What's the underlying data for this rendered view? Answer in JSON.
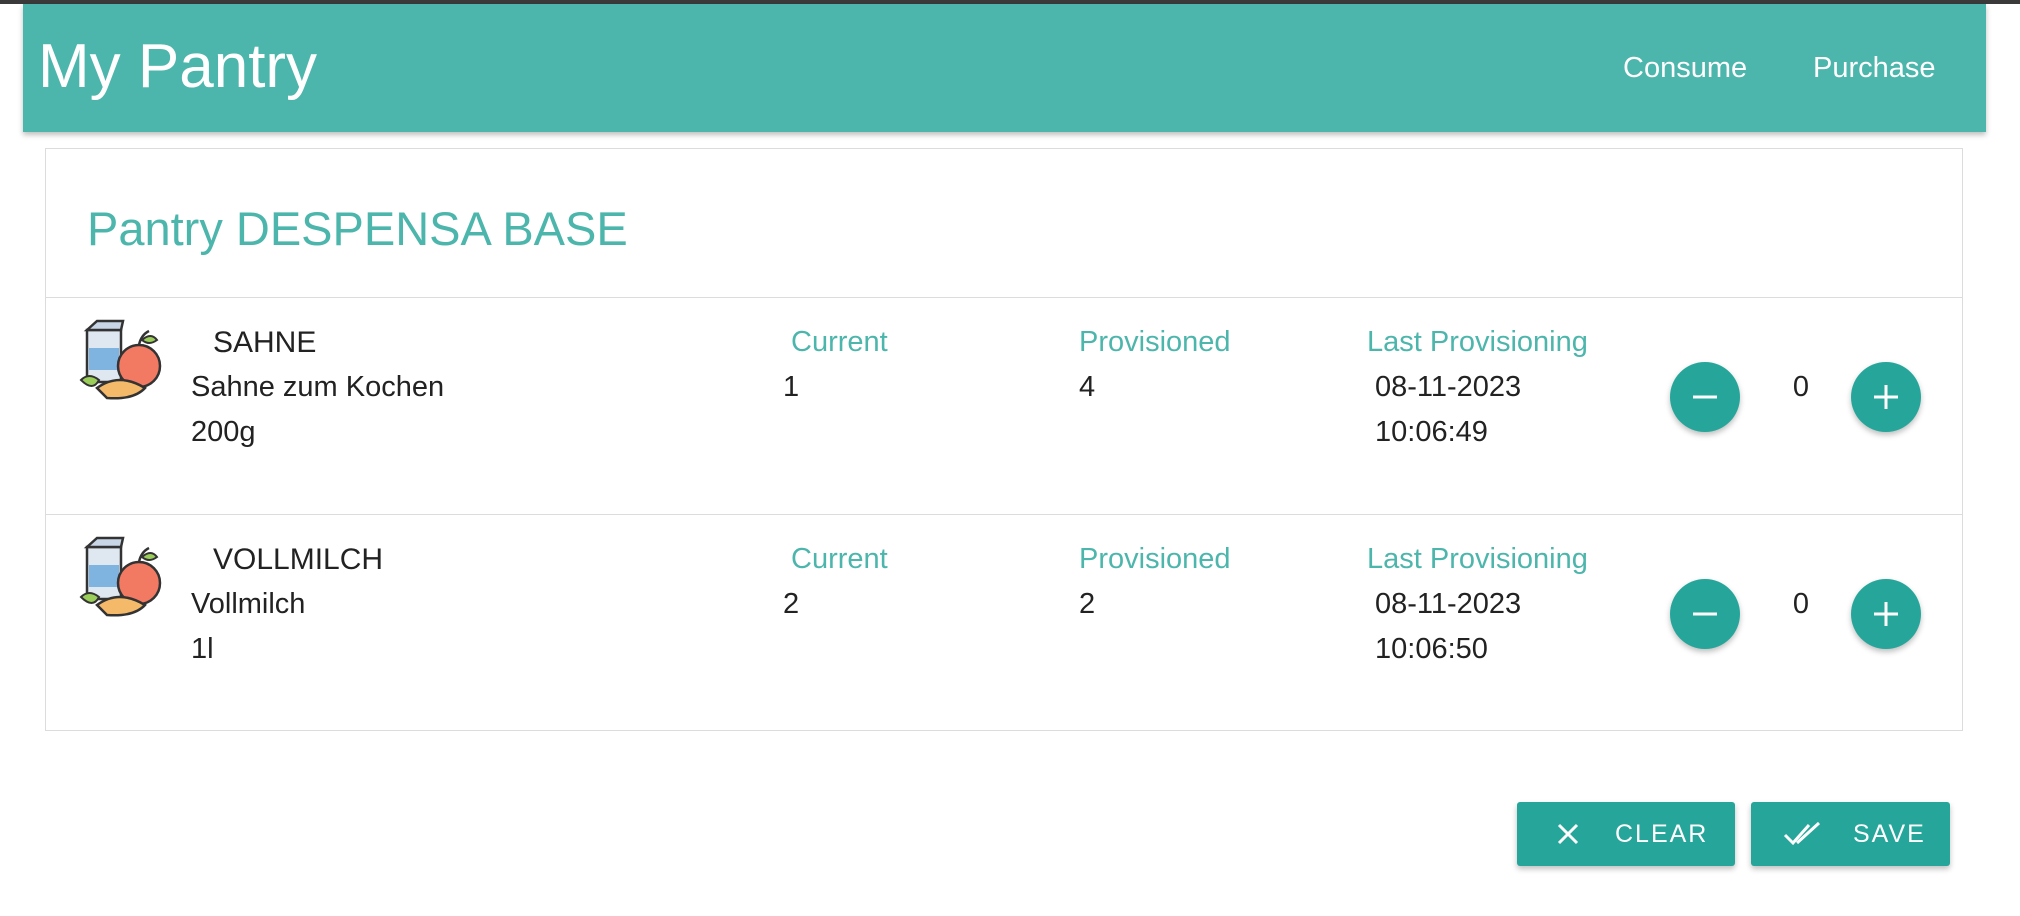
{
  "header": {
    "title": "My Pantry",
    "nav": {
      "consume": "Consume",
      "purchase": "Purchase"
    }
  },
  "pantry": {
    "title": "Pantry DESPENSA BASE",
    "columns": {
      "current": "Current",
      "provisioned": "Provisioned",
      "last_provisioning": "Last Provisioning"
    },
    "items": [
      {
        "name": "SAHNE",
        "description": "Sahne zum Kochen",
        "quantity": "200g",
        "current": "1",
        "provisioned": "4",
        "last_date": "08-11-2023",
        "last_time": "10:06:49",
        "counter": "0",
        "icon": "groceries-icon"
      },
      {
        "name": "VOLLMILCH",
        "description": "Vollmilch",
        "quantity": "1l",
        "current": "2",
        "provisioned": "2",
        "last_date": "08-11-2023",
        "last_time": "10:06:50",
        "counter": "0",
        "icon": "groceries-icon"
      }
    ]
  },
  "actions": {
    "clear": "CLEAR",
    "save": "SAVE"
  },
  "colors": {
    "toolbar": "#4db6ac",
    "accent": "#26a69a",
    "label": "#4db6ac"
  }
}
